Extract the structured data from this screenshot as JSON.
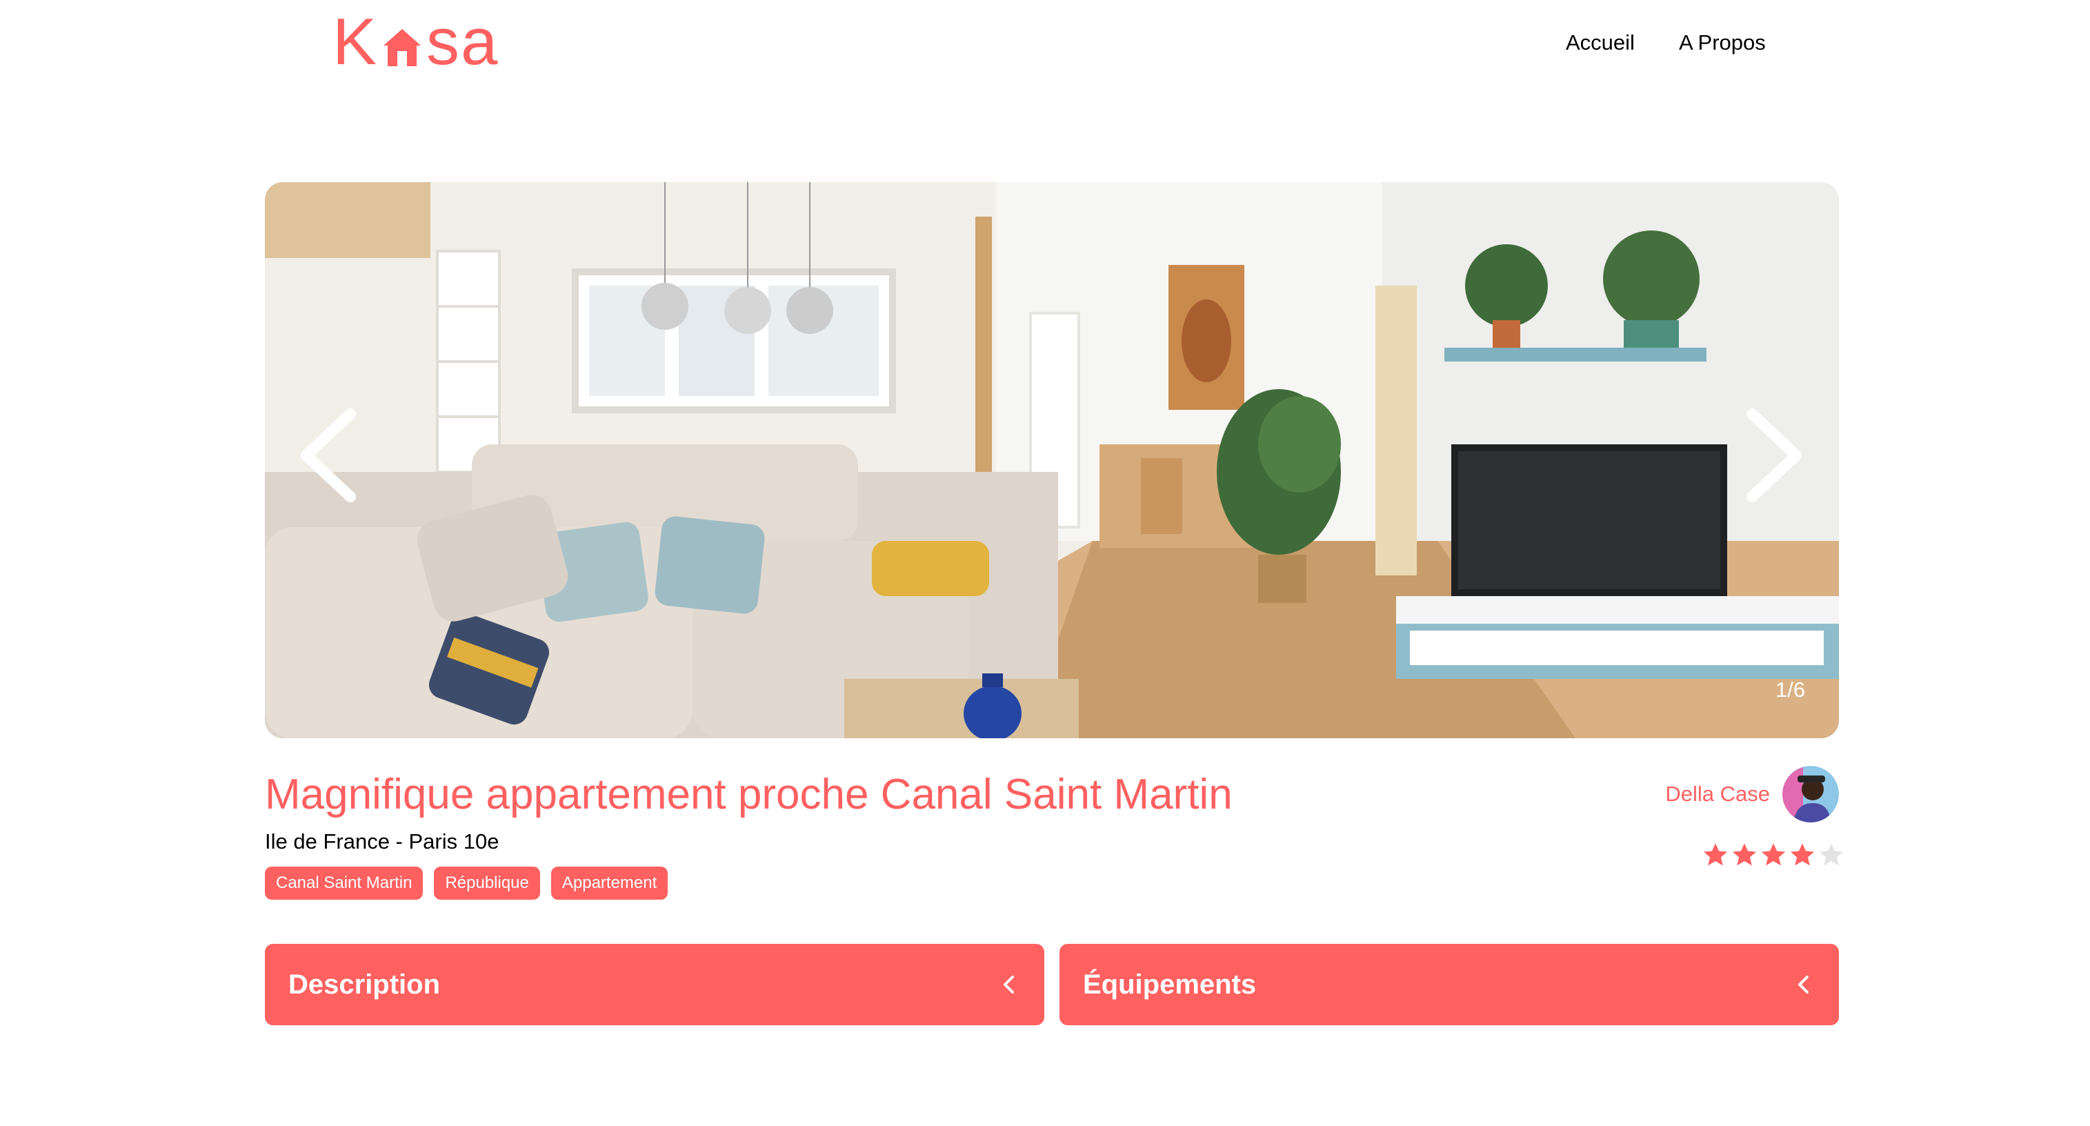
{
  "header": {
    "logo": "Kasa",
    "logo_parts": [
      "K",
      "sa"
    ],
    "nav": [
      "Accueil",
      "A Propos"
    ]
  },
  "gallery": {
    "counter": "1/6",
    "current": 1,
    "total": 6
  },
  "listing": {
    "title": "Magnifique appartement proche Canal Saint Martin",
    "location": "Ile de France - Paris 10e",
    "tags": [
      "Canal Saint Martin",
      "République",
      "Appartement"
    ],
    "host": {
      "name": "Della Case"
    },
    "rating": 4,
    "rating_max": 5
  },
  "collapses": {
    "description": "Description",
    "equipments": "Équipements"
  },
  "colors": {
    "accent": "#FF6060",
    "star_empty": "#E3E3E3",
    "text": "#000000"
  },
  "icons": [
    "house-icon",
    "chevron-left-icon",
    "chevron-right-icon",
    "star-icon",
    "chevron-down-icon"
  ]
}
